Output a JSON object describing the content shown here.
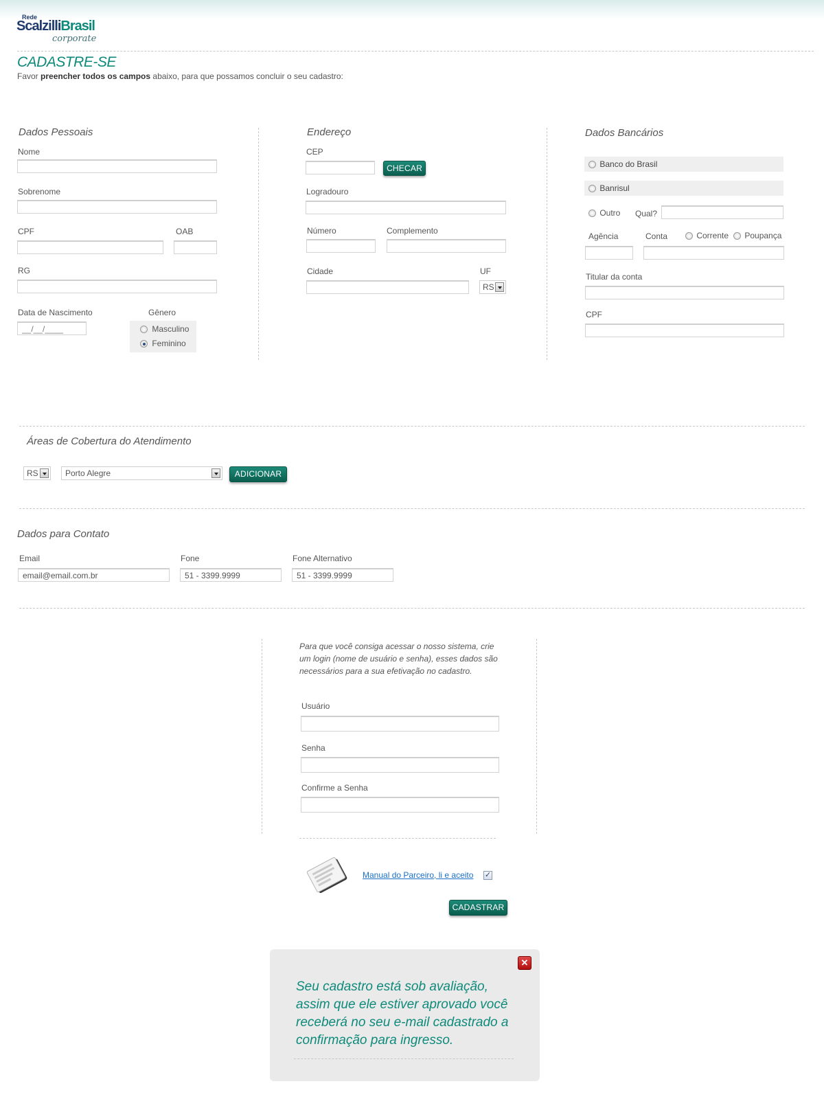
{
  "brand": {
    "rede": "Rede",
    "name_main": "Scalzilli",
    "name_brasil": "Brasil",
    "tagline": "corporate"
  },
  "header": {
    "title": "CADASTRE-SE",
    "intro_pre": "Favor ",
    "intro_bold": "preencher todos os campos",
    "intro_post": " abaixo, para que possamos concluir o seu cadastro:"
  },
  "personal": {
    "title": "Dados Pessoais",
    "nome": "Nome",
    "sobrenome": "Sobrenome",
    "cpf": "CPF",
    "oab": "OAB",
    "rg": "RG",
    "nascimento": "Data de Nascimento",
    "nascimento_placeholder": "__/__/____",
    "genero": "Gênero",
    "masculino": "Masculino",
    "feminino": "Feminino",
    "selected_gender": "Feminino"
  },
  "address": {
    "title": "Endereço",
    "cep": "CEP",
    "checar": "CHECAR",
    "logradouro": "Logradouro",
    "numero": "Número",
    "complemento": "Complemento",
    "cidade": "Cidade",
    "uf": "UF",
    "uf_value": "RS"
  },
  "bank": {
    "title": "Dados Bancários",
    "banco_brasil": "Banco do Brasil",
    "banrisul": "Banrisul",
    "outro": "Outro",
    "qual": "Qual?",
    "agencia": "Agência",
    "conta": "Conta",
    "corrente": "Corrente",
    "poupanca": "Poupança",
    "titular": "Titular da conta",
    "cpf": "CPF"
  },
  "coverage": {
    "title": "Áreas de Cobertura do Atendimento",
    "uf_value": "RS",
    "city_value": "Porto Alegre",
    "adicionar": "ADICIONAR"
  },
  "contact": {
    "title": "Dados para Contato",
    "email": "Email",
    "email_value": "email@email.com.br",
    "fone": "Fone",
    "fone_value": "51 - 3399.9999",
    "fone_alt": "Fone Alternativo",
    "fone_alt_value": "51 - 3399.9999"
  },
  "login": {
    "note": "Para que você consiga acessar o nosso sistema, crie um login (nome de usuário e senha), esses dados são necessários para a sua efetivação no cadastro.",
    "usuario": "Usuário",
    "senha": "Senha",
    "confirme": "Confirme a Senha",
    "manual_link": "Manual do Parceiro, li e aceito",
    "manual_checked": true,
    "cadastrar": "CADASTRAR"
  },
  "popup": {
    "message": "Seu cadastro está sob avaliação, assim que ele estiver aprovado você receberá no seu e-mail cadastrado a confirmação para ingresso.",
    "close_symbol": "✕"
  },
  "colors": {
    "accent": "#0d8a7a",
    "button": "#0b5e50",
    "link": "#1a6fc7",
    "close": "#c41a1a"
  }
}
